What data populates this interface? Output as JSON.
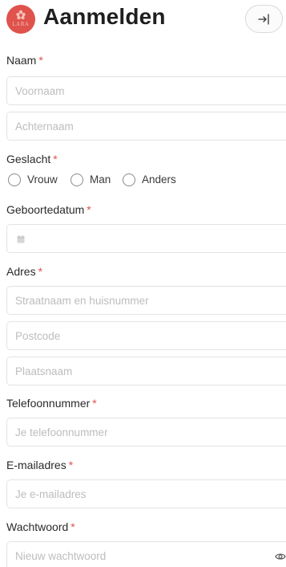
{
  "header": {
    "title": "Aanmelden",
    "logo_text": "LARA",
    "login_icon": "login-arrow-icon"
  },
  "colors": {
    "accent": "#e0524c",
    "border": "#e3e3e3",
    "placeholder": "#bdbdbd"
  },
  "form": {
    "name": {
      "label": "Naam",
      "required": "*",
      "first_placeholder": "Voornaam",
      "last_placeholder": "Achternaam"
    },
    "gender": {
      "label": "Geslacht",
      "required": "*",
      "options": [
        "Vrouw",
        "Man",
        "Anders"
      ]
    },
    "birthdate": {
      "label": "Geboortedatum",
      "required": "*",
      "icon": "calendar-icon"
    },
    "address": {
      "label": "Adres",
      "required": "*",
      "street_placeholder": "Straatnaam en huisnummer",
      "postcode_placeholder": "Postcode",
      "city_placeholder": "Plaatsnaam"
    },
    "phone": {
      "label": "Telefoonnummer",
      "required": "*",
      "placeholder": "Je telefoonnummer"
    },
    "email": {
      "label": "E-mailadres",
      "required": "*",
      "placeholder": "Je e-mailadres"
    },
    "password": {
      "label": "Wachtwoord",
      "required": "*",
      "placeholder": "Nieuw wachtwoord",
      "icon": "eye-icon"
    }
  }
}
